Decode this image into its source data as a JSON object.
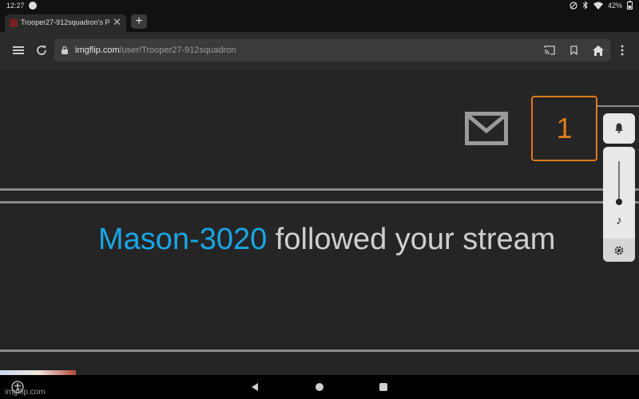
{
  "status_bar": {
    "time": "12:27",
    "battery": "42%"
  },
  "tab": {
    "title": "Trooper27-912squadron's Pr",
    "close": "✕",
    "new_tab": "+"
  },
  "address_bar": {
    "domain": "imgflip.com",
    "path": "/user/Trooper27-912squadron"
  },
  "notifications": {
    "count": "1"
  },
  "message": {
    "username": "Mason-3020",
    "text": " followed your stream"
  },
  "volume_panel": {
    "level": 0.0
  },
  "watermark": "imgflip.com",
  "colors": {
    "accent_orange": "#e07a1a",
    "link_blue": "#1aa6e6",
    "page_bg": "#252525"
  }
}
